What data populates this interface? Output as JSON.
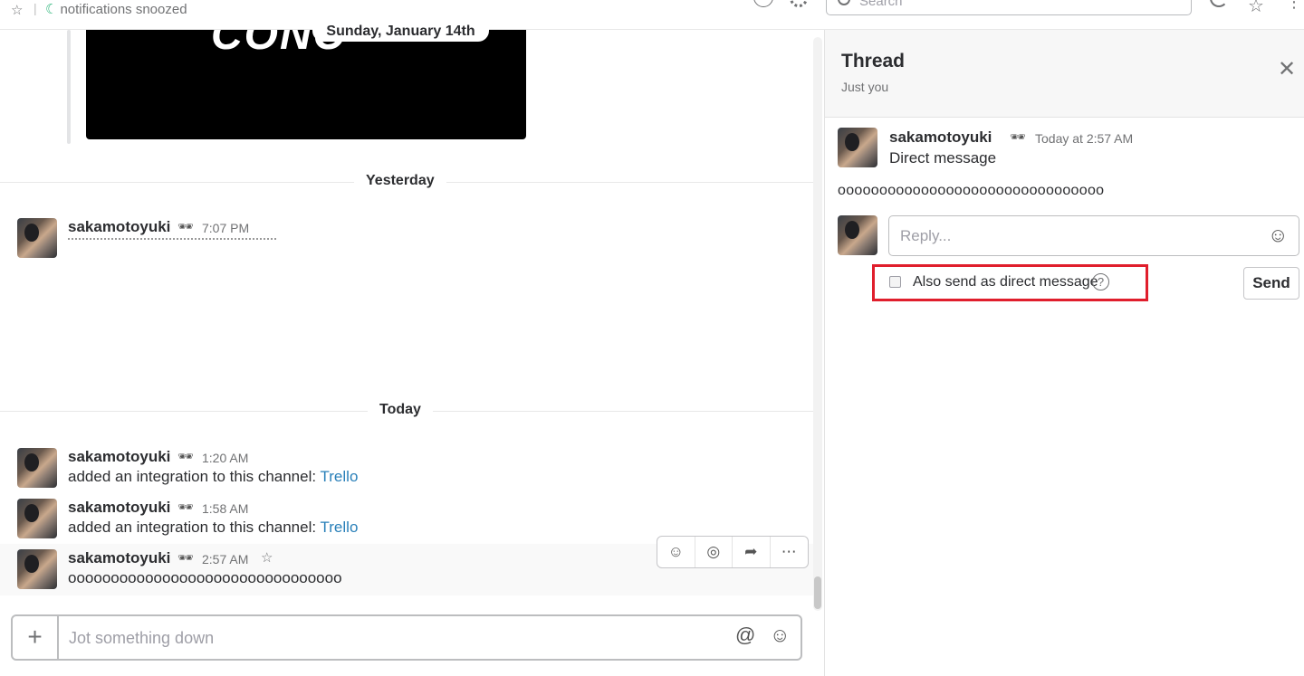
{
  "topbar": {
    "star_icon": "star-outline-icon",
    "notifications": "notifications snoozed",
    "search_placeholder": "Search"
  },
  "messages": {
    "date_pill": "Sunday, January 14th",
    "video_text": "CONC",
    "dividers": {
      "yesterday": "Yesterday",
      "today": "Today"
    },
    "items": [
      {
        "user": "sakamotoyuki",
        "status_icon": "glasses-icon",
        "time": "7:07 PM",
        "body": ""
      },
      {
        "user": "sakamotoyuki",
        "status_icon": "glasses-icon",
        "time": "1:20 AM",
        "body_prefix": "added an integration to this channel: ",
        "link": "Trello"
      },
      {
        "user": "sakamotoyuki",
        "status_icon": "glasses-icon",
        "time": "1:58 AM",
        "body_prefix": "added an integration to this channel: ",
        "link": "Trello"
      },
      {
        "user": "sakamotoyuki",
        "status_icon": "glasses-icon",
        "time": "2:57 AM",
        "body": "oooooooooooooooooooooooooooooooo"
      }
    ],
    "actions": [
      "add-reaction-icon",
      "start-thread-icon",
      "share-icon",
      "more-actions-icon"
    ]
  },
  "composer": {
    "placeholder": "Jot something down",
    "plus": "+",
    "at": "@",
    "emoji": "☺"
  },
  "thread": {
    "title": "Thread",
    "subtitle": "Just you",
    "close": "✕",
    "message": {
      "user": "sakamotoyuki",
      "time": "Today at 2:57 AM",
      "body": "Direct message"
    },
    "text": "oooooooooooooooooooooooooooooooo",
    "reply_placeholder": "Reply...",
    "also_send_label": "Also send as direct message",
    "also_send_checked": false,
    "help": "?",
    "send_label": "Send",
    "highlight_color": "#e01e2c"
  }
}
